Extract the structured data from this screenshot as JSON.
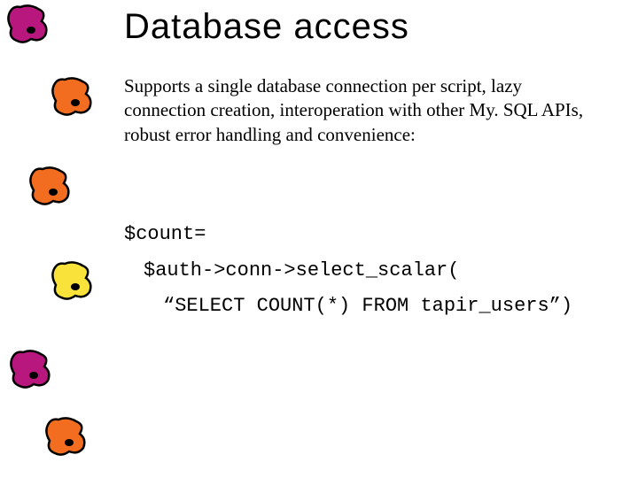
{
  "slide": {
    "title": "Database access",
    "body": "Supports a single database connection per script,  lazy connection creation,  interoperation with other My. SQL APIs,  robust error handling and convenience:",
    "code": {
      "line1": "$count=",
      "line2": "$auth->conn->select_scalar(",
      "line3": "“SELECT COUNT(*) FROM tapir_users”)"
    }
  },
  "bullets": {
    "colors": [
      "#b8177d",
      "#f26d1f",
      "#f26d1f",
      "#f9e33b",
      "#b8177d",
      "#f26d1f"
    ],
    "outline": "#000"
  }
}
